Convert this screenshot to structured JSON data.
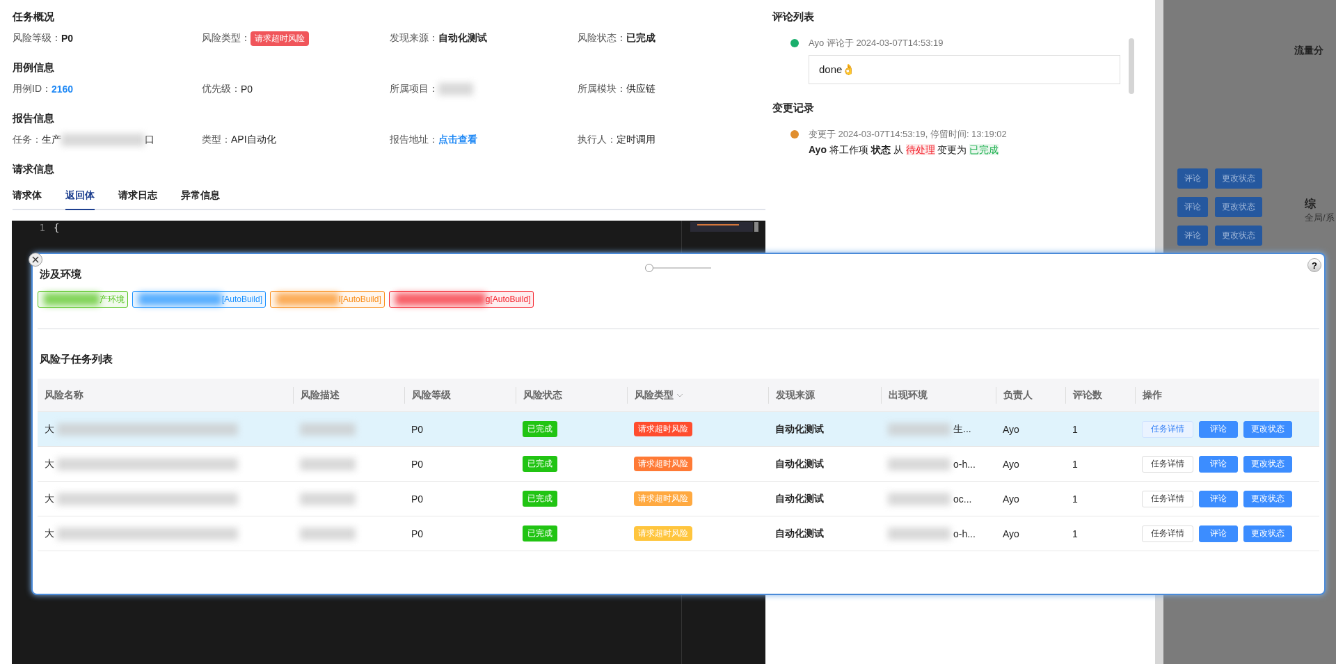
{
  "overview": {
    "title": "任务概况",
    "fields": [
      {
        "label": "风险等级：",
        "kind": "bold",
        "value": "P0"
      },
      {
        "label": "风险类型：",
        "kind": "tag",
        "value": "请求超时风险",
        "color": "#f0555a"
      },
      {
        "label": "发现来源：",
        "kind": "bold",
        "value": "自动化测试"
      },
      {
        "label": "风险状态：",
        "kind": "bold",
        "value": "已完成"
      }
    ]
  },
  "case_info": {
    "title": "用例信息",
    "fields": [
      {
        "label": "用例ID：",
        "kind": "link",
        "value": "2160"
      },
      {
        "label": "优先级：",
        "kind": "plain",
        "value": "P0"
      },
      {
        "label": "所属项目：",
        "kind": "redacted"
      },
      {
        "label": "所属模块：",
        "kind": "plain",
        "value": "供应链"
      }
    ]
  },
  "report_info": {
    "title": "报告信息",
    "fields": [
      {
        "label": "任务：",
        "kind": "partial",
        "value": "生产",
        "tail": "口"
      },
      {
        "label": "类型：",
        "kind": "plain",
        "value": "API自动化"
      },
      {
        "label": "报告地址：",
        "kind": "link",
        "value": "点击查看"
      },
      {
        "label": "执行人：",
        "kind": "plain",
        "value": "定时调用"
      }
    ]
  },
  "request_info": {
    "title": "请求信息",
    "tabs": [
      {
        "label": "请求体",
        "selected": false
      },
      {
        "label": "返回体",
        "selected": true
      },
      {
        "label": "请求日志",
        "selected": false
      },
      {
        "label": "异常信息",
        "selected": false
      }
    ],
    "editor": {
      "line_number": "1",
      "code": "{"
    }
  },
  "comments": {
    "title": "评论列表",
    "items": [
      {
        "meta": "Ayo 评论于 2024-03-07T14:53:19",
        "text": "done👌",
        "color": "#1aaf6c"
      }
    ]
  },
  "changes": {
    "title": "变更记录",
    "items": [
      {
        "meta": "变更于 2024-03-07T14:53:19, 停留时间: 13:19:02",
        "actor": "Ayo",
        "action": "将工作项",
        "field": "状态",
        "from_word": "从",
        "old": "待处理",
        "to_word": "变更为",
        "new": "已完成",
        "color": "#e08e2e"
      }
    ]
  },
  "background_page": {
    "label": "流量分",
    "rows": [
      {
        "buttons": [
          "评论",
          "更改状态"
        ]
      },
      {
        "buttons": [
          "评论",
          "更改状态"
        ]
      },
      {
        "buttons": [
          "评论",
          "更改状态"
        ]
      }
    ],
    "section": "综",
    "subtitle": "全局/系"
  },
  "modal": {
    "zoom_slider": {
      "level": 0
    },
    "help": "?",
    "env_title": "涉及环境",
    "env_tags": [
      {
        "text": "产环境",
        "color": "#52c41a"
      },
      {
        "text": "[AutoBuild]",
        "color": "#1890ff"
      },
      {
        "text": "l[AutoBuild]",
        "color": "#fa8c16"
      },
      {
        "text": "g[AutoBuild]",
        "color": "#f5222d"
      }
    ],
    "list_title": "风险子任务列表",
    "columns": [
      {
        "label": "风险名称"
      },
      {
        "label": "风险描述"
      },
      {
        "label": "风险等级"
      },
      {
        "label": "风险状态"
      },
      {
        "label": "风险类型",
        "filter": true
      },
      {
        "label": "发现来源"
      },
      {
        "label": "出现环境"
      },
      {
        "label": "负责人"
      },
      {
        "label": "评论数"
      },
      {
        "label": "操作"
      }
    ],
    "rows": [
      {
        "selected": true,
        "name": "大",
        "priority": "P0",
        "status": "已完成",
        "type": "请求超时风险",
        "color": "#ff4d2e",
        "source": "自动化测试",
        "env": "生...",
        "owner": "Ayo",
        "comment_count": "1",
        "actions": [
          "任务详情",
          "评论",
          "更改状态"
        ]
      },
      {
        "selected": false,
        "name": "大",
        "priority": "P0",
        "status": "已完成",
        "type": "请求超时风险",
        "color": "#ff7a35",
        "source": "自动化测试",
        "env": "o-h...",
        "owner": "Ayo",
        "comment_count": "1",
        "actions": [
          "任务详情",
          "评论",
          "更改状态"
        ]
      },
      {
        "selected": false,
        "name": "大",
        "priority": "P0",
        "status": "已完成",
        "type": "请求超时风险",
        "color": "#ffa940",
        "source": "自动化测试",
        "env": "oc...",
        "owner": "Ayo",
        "comment_count": "1",
        "actions": [
          "任务详情",
          "评论",
          "更改状态"
        ]
      },
      {
        "selected": false,
        "name": "大",
        "priority": "P0",
        "status": "已完成",
        "type": "请求超时风险",
        "color": "#ffc53d",
        "source": "自动化测试",
        "env": "o-h...",
        "owner": "Ayo",
        "comment_count": "1",
        "actions": [
          "任务详情",
          "评论",
          "更改状态"
        ]
      }
    ]
  }
}
